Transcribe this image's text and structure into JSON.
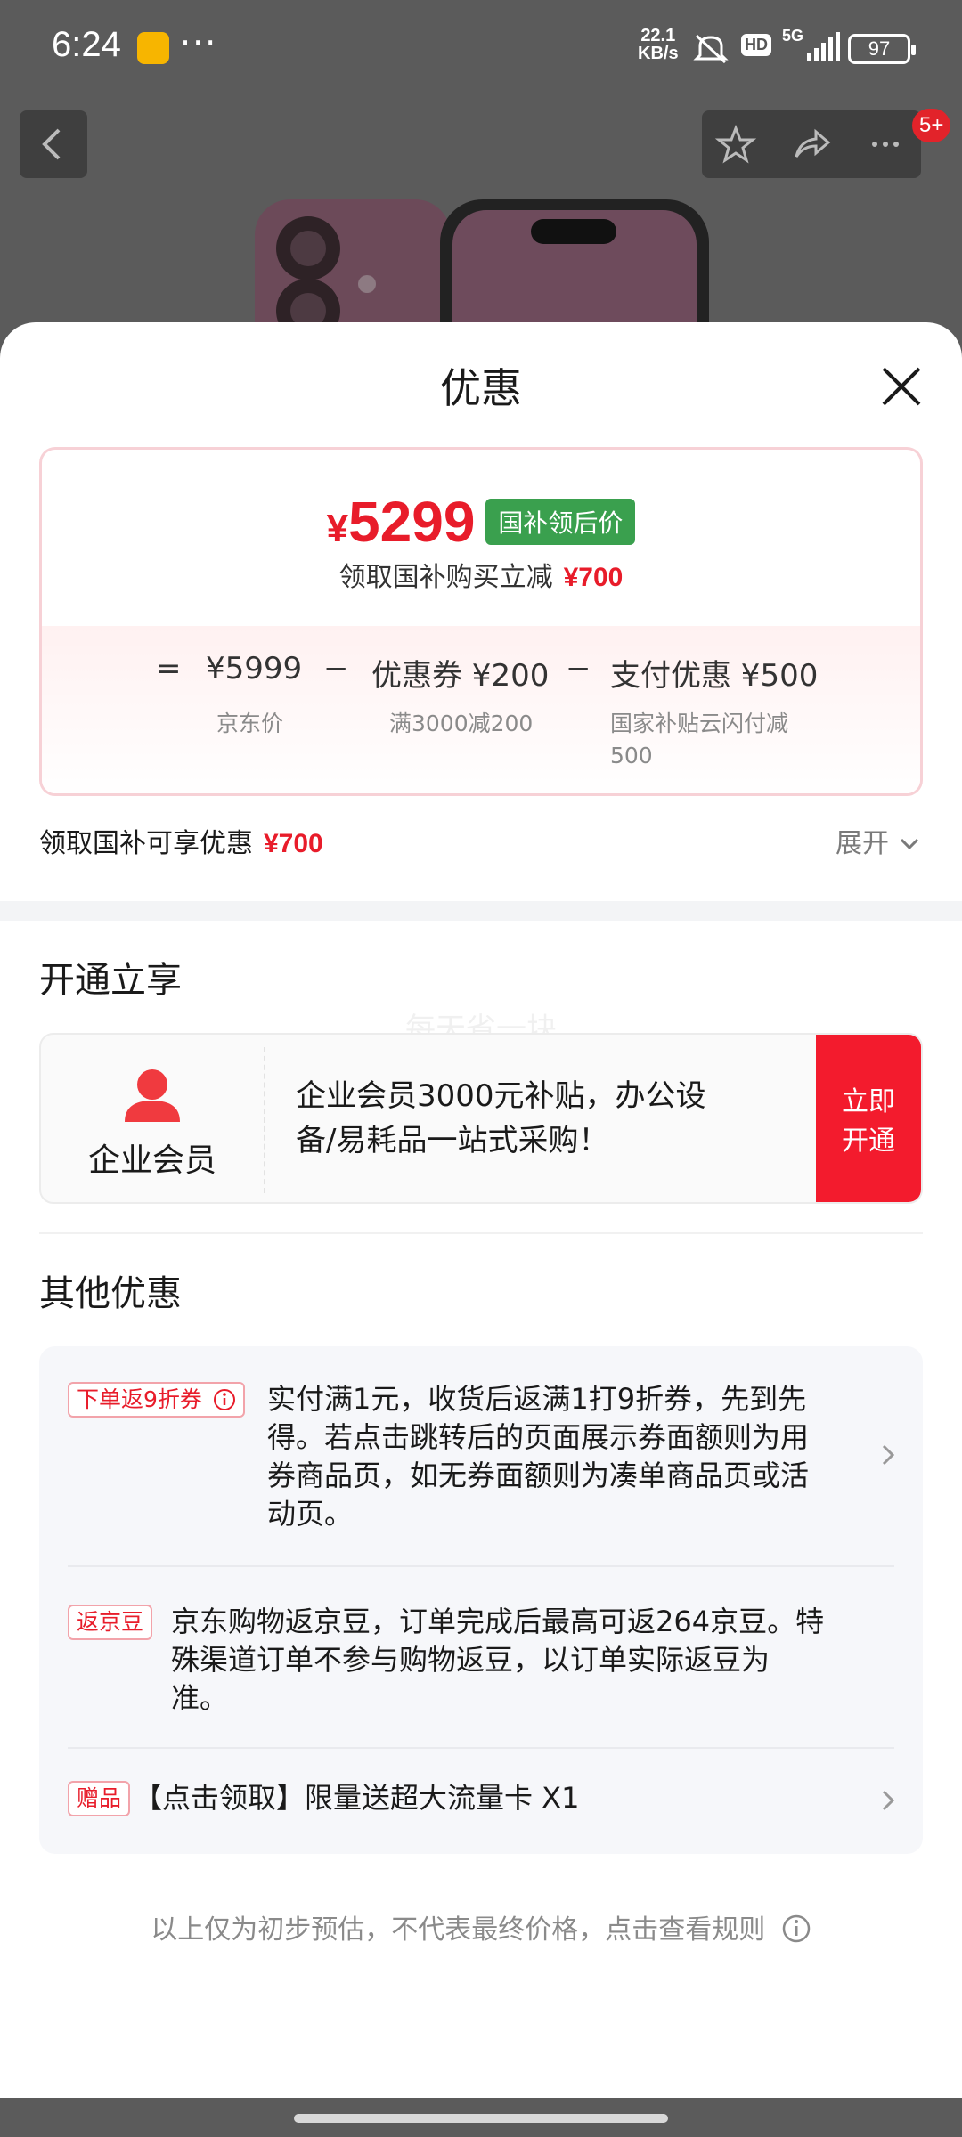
{
  "status_bar": {
    "time": "6:24",
    "net_speed_value": "22.1",
    "net_speed_unit": "KB/s",
    "hd_label": "HD",
    "network_label": "5G",
    "battery": "97"
  },
  "top_nav": {
    "cart_badge": "5+"
  },
  "sheet": {
    "title": "优惠",
    "price_card": {
      "currency": "¥",
      "final_price": "5299",
      "final_price_tag": "国补领后价",
      "subsidy_text": "领取国补购买立减",
      "subsidy_amount": "¥700",
      "equals": "=",
      "minus": "−",
      "breakdown": [
        {
          "label": "¥5999",
          "note": "京东价"
        },
        {
          "label": "优惠券 ¥200",
          "note": "满3000减200"
        },
        {
          "label": "支付优惠 ¥500",
          "note_line1": "国家补贴云闪付减",
          "note_line2": "500"
        }
      ]
    },
    "discount_summary": {
      "text": "领取国补可享优惠",
      "amount": "¥700",
      "expand_label": "展开"
    },
    "open_section": {
      "title": "开通立享",
      "member": {
        "label": "企业会员",
        "desc_line1": "企业会员3000元补贴，办公设",
        "desc_line2": "备/易耗品一站式采购！",
        "button_line1": "立即",
        "button_line2": "开通"
      }
    },
    "watermark": "每天省一块",
    "other_section": {
      "title": "其他优惠",
      "items": [
        {
          "tag": "下单返9折券",
          "lines": [
            "实付满1元，收货后返满1打9折券，先到先",
            "得。若点击跳转后的页面展示券面额则为用",
            "券商品页，如无券面额则为凑单商品页或活",
            "动页。"
          ]
        },
        {
          "tag": "返京豆",
          "lines": [
            "京东购物返京豆，订单完成后最高可返264京豆。特",
            "殊渠道订单不参与购物返豆，以订单实际返豆为",
            "准。"
          ]
        },
        {
          "tag": "赠品",
          "lines": [
            "【点击领取】限量送超大流量卡 X1"
          ]
        }
      ]
    },
    "footnote": "以上仅为初步预估，不代表最终价格，点击查看规则"
  },
  "colors": {
    "accent_red": "#e81c2a",
    "tag_green": "#3aa04e",
    "button_red": "#f31b2d"
  }
}
